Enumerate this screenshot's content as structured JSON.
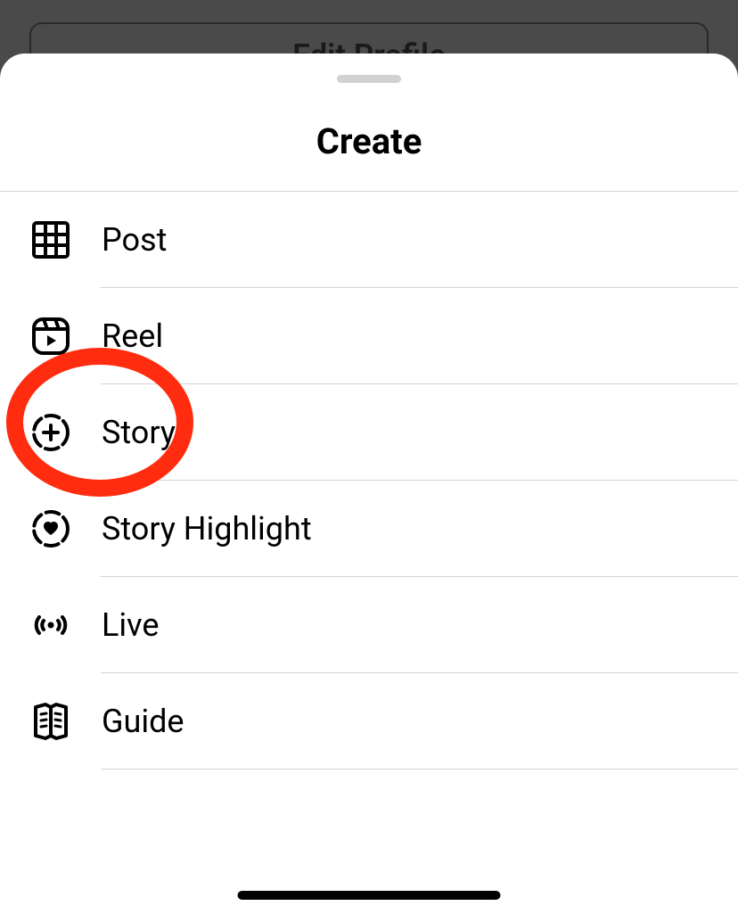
{
  "background": {
    "edit_profile_label": "Edit Profile"
  },
  "sheet": {
    "title": "Create",
    "items": [
      {
        "id": "post",
        "label": "Post",
        "icon": "grid-icon"
      },
      {
        "id": "reel",
        "label": "Reel",
        "icon": "reel-icon"
      },
      {
        "id": "story",
        "label": "Story",
        "icon": "story-plus-icon"
      },
      {
        "id": "story-highlight",
        "label": "Story Highlight",
        "icon": "story-heart-icon"
      },
      {
        "id": "live",
        "label": "Live",
        "icon": "live-icon"
      },
      {
        "id": "guide",
        "label": "Guide",
        "icon": "guide-icon"
      }
    ]
  },
  "annotation": {
    "highlighted_item": "story",
    "color": "#ff2c0f"
  }
}
